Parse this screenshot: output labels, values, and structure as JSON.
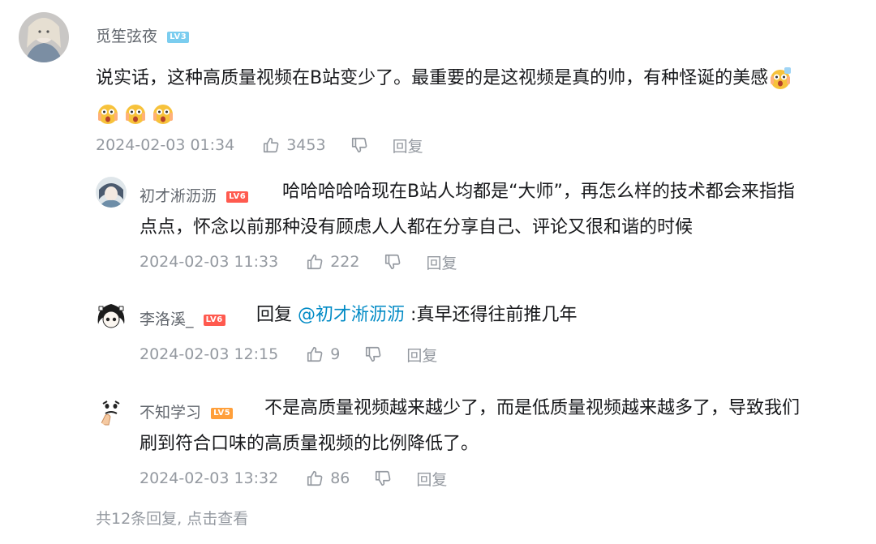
{
  "main_comment": {
    "username": "觅笙弦夜",
    "level": "LV3",
    "text": "说实话，这种高质量视频在B站变少了。最重要的是这视频是真的帅，有种怪诞的美感",
    "time": "2024-02-03 01:34",
    "likes": "3453",
    "reply_label": "回复"
  },
  "replies": [
    {
      "username": "初才淅沥沥",
      "level": "LV6",
      "text_line1": "哈哈哈哈哈现在B站人均都是“大师”，再怎么样的技术都会来指指",
      "text_line2": "点点，怀念以前那种没有顾虑人人都在分享自己、评论又很和谐的时候",
      "time": "2024-02-03 11:33",
      "likes": "222",
      "reply_label": "回复"
    },
    {
      "username": "李洛溪_",
      "level": "LV6",
      "reply_prefix": "回复",
      "mention": "@初才淅沥沥",
      "text": ":真早还得往前推几年",
      "time": "2024-02-03 12:15",
      "likes": "9",
      "reply_label": "回复"
    },
    {
      "username": "不知学习",
      "level": "LV5",
      "text_line1": "不是高质量视频越来越少了，而是低质量视频越来越多了，导致我们",
      "text_line2": "刷到符合口味的高质量视频的比例降低了。",
      "time": "2024-02-03 13:32",
      "likes": "86",
      "reply_label": "回复"
    }
  ],
  "footer": {
    "count_text": "共12条回复,",
    "action_text": "点击查看"
  },
  "icons": {
    "like": "thumbs-up-icon",
    "dislike": "thumbs-down-icon",
    "emoji": "scared-face-emoji"
  },
  "colors": {
    "text": "#18191c",
    "meta": "#9499a0",
    "mention": "#008ac5",
    "lv3": "#7bcdef",
    "lv6": "#ff5a4f",
    "lv5": "#ff9f3a"
  }
}
